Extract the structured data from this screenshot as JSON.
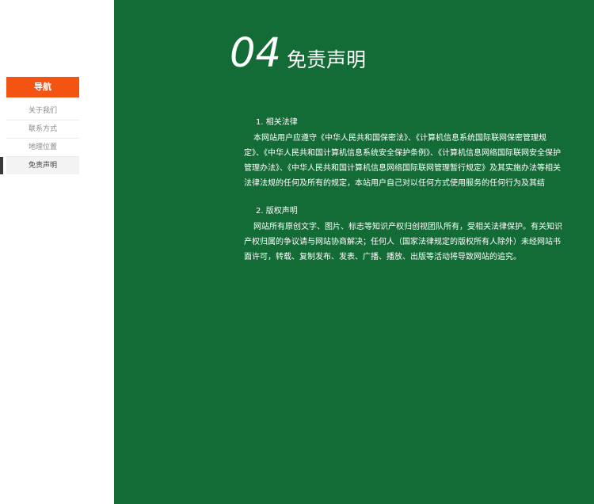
{
  "sidebar": {
    "header": "导航",
    "items": [
      {
        "label": "关于我们"
      },
      {
        "label": "联系方式"
      },
      {
        "label": "地理位置"
      },
      {
        "label": "免责声明"
      }
    ]
  },
  "page": {
    "number": "04",
    "title": "免责声明"
  },
  "sections": [
    {
      "title": "1. 相关法律",
      "body": "本网站用户应遵守《中华人民共和国保密法》、《计算机信息系统国际联网保密管理规定》、《中华人民共和国计算机信息系统安全保护条例》、《计算机信息网络国际联网安全保护管理办法》、《中华人民共和国计算机信息网络国际联网管理暂行规定》及其实施办法等相关法律法规的任何及所有的规定，本站用户自己对以任何方式使用服务的任何行为及其结"
    },
    {
      "title": "2. 版权声明",
      "body": "网站所有原创文字、图片、标志等知识产权归创视团队所有，受相关法律保护。有关知识产权归属的争议请与网站协商解决；任何人（国家法律规定的版权所有人除外）未经网站书面许可，转载、复制发布、发表、广播、播放、出版等活动将导致网站的追究。"
    }
  ],
  "colors": {
    "accent": "#f45412",
    "content_bg": "#136b36",
    "active_marker": "#3a3a3a"
  }
}
